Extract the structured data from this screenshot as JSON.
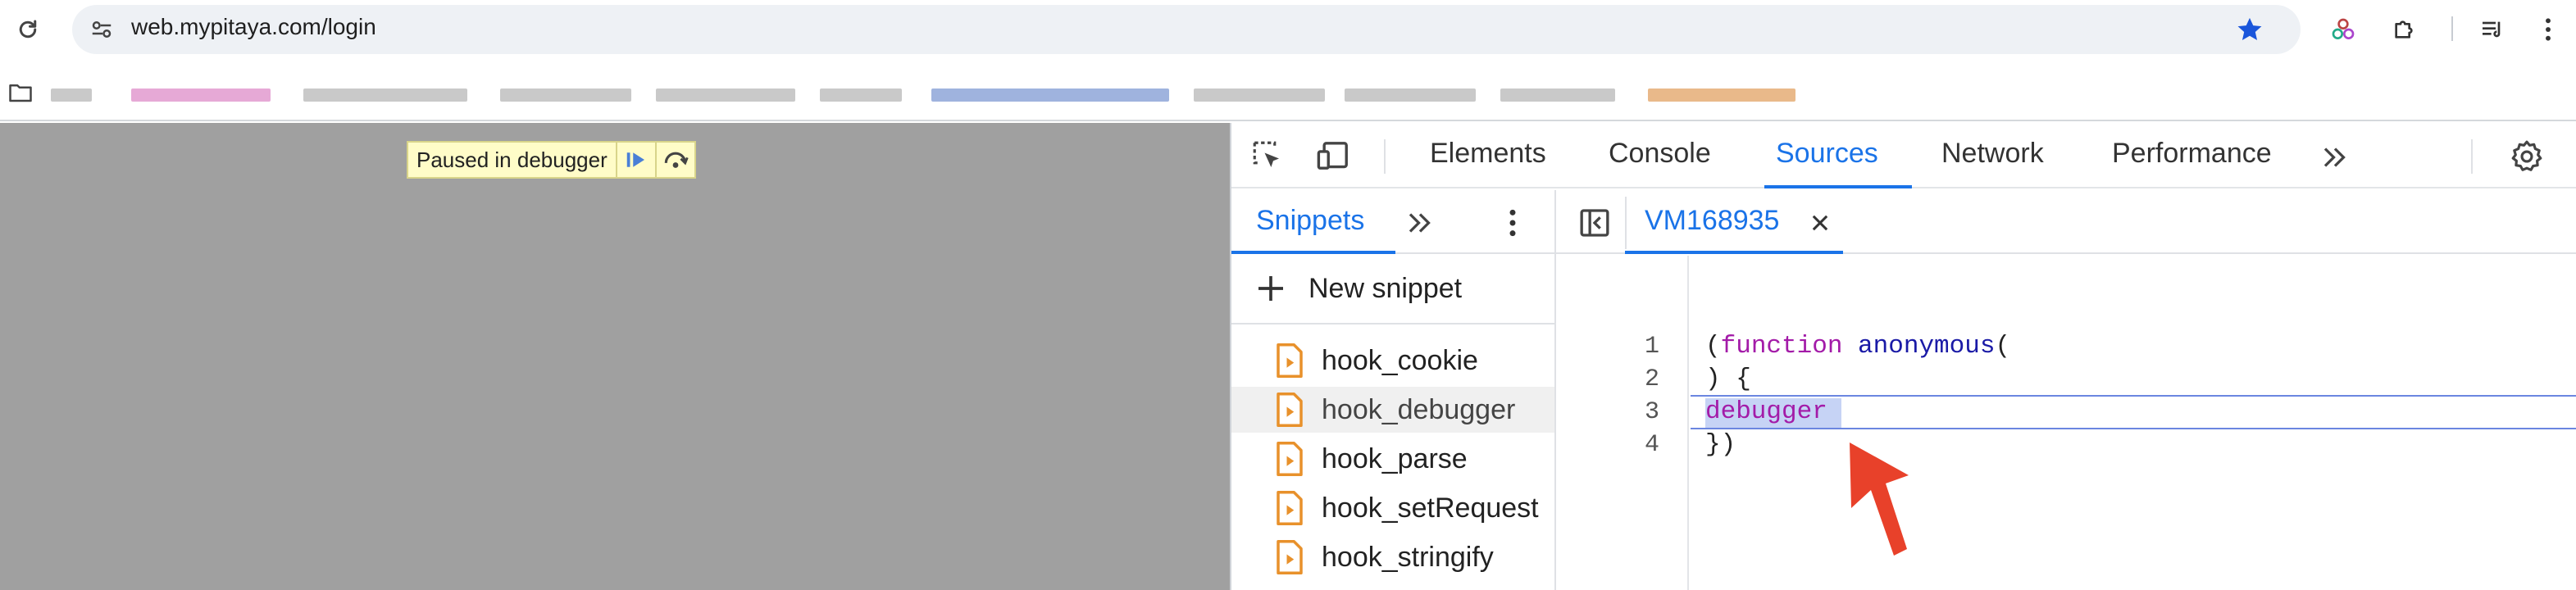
{
  "browser": {
    "url": "web.mypitaya.com/login"
  },
  "page": {
    "paused_label": "Paused in debugger"
  },
  "devtools": {
    "tabs": [
      "Elements",
      "Console",
      "Sources",
      "Network",
      "Performance"
    ],
    "active_tab": "Sources",
    "left_pane": {
      "tab_label": "Snippets",
      "new_snippet_label": "New snippet",
      "files": [
        "hook_cookie",
        "hook_debugger",
        "hook_parse",
        "hook_setRequest",
        "hook_stringify"
      ],
      "selected_file": "hook_debugger"
    },
    "editor": {
      "tab_label": "VM168935",
      "line_numbers": [
        "1",
        "2",
        "3",
        "4"
      ],
      "code": {
        "l1_paren": "(",
        "l1_kw": "function",
        "l1_name": "anonymous",
        "l1_paren2": "(",
        "l2": ") {",
        "l3": "debugger",
        "l4": "})"
      },
      "highlighted_line": 3
    }
  },
  "colors": {
    "accent": "#1a73e8",
    "keyword": "#a31ba8",
    "identifier": "#1a1aa6",
    "page_bg": "#a0a0a0",
    "paused_bg": "#fffcc8",
    "arrow": "#e8412a",
    "snippet_icon": "#e8912b"
  }
}
